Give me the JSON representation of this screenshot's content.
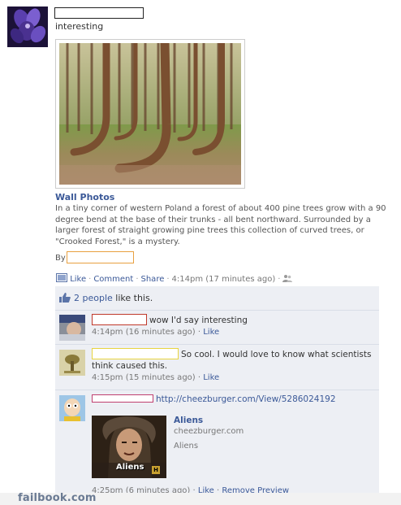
{
  "post": {
    "text": "interesting",
    "album_title": "Wall Photos",
    "description": "In a tiny corner of western Poland a forest of about 400 pine trees grow with a 90 degree bend at the base of their trunks - all bent northward. Surrounded by a larger forest of straight growing pine trees this collection of curved trees, or \"Crooked Forest,\" is a mystery.",
    "by_label": "By"
  },
  "actions": {
    "like": "Like",
    "comment": "Comment",
    "share": "Share",
    "time": "4:14pm (17 minutes ago)"
  },
  "likes": {
    "count_text": "2 people",
    "suffix": "like this."
  },
  "comments": [
    {
      "text": "wow I'd say interesting",
      "time": "4:14pm (16 minutes ago)",
      "like": "Like"
    },
    {
      "text": "So cool. I would love to know what scientists think caused this.",
      "time": "4:15pm (15 minutes ago)",
      "like": "Like"
    },
    {
      "link": "http://cheezburger.com/View/5286024192",
      "time": "4:25pm (6 minutes ago)",
      "like": "Like",
      "remove": "Remove Preview"
    }
  ],
  "preview": {
    "title": "Aliens",
    "domain": "cheezburger.com",
    "caption": "Aliens",
    "image_text": "Aliens",
    "badge": "H"
  },
  "watermark": "failbook.com",
  "colors": {
    "link": "#3b5998",
    "feedback_bg": "#edeff4",
    "watermark": "#6a7a93"
  }
}
